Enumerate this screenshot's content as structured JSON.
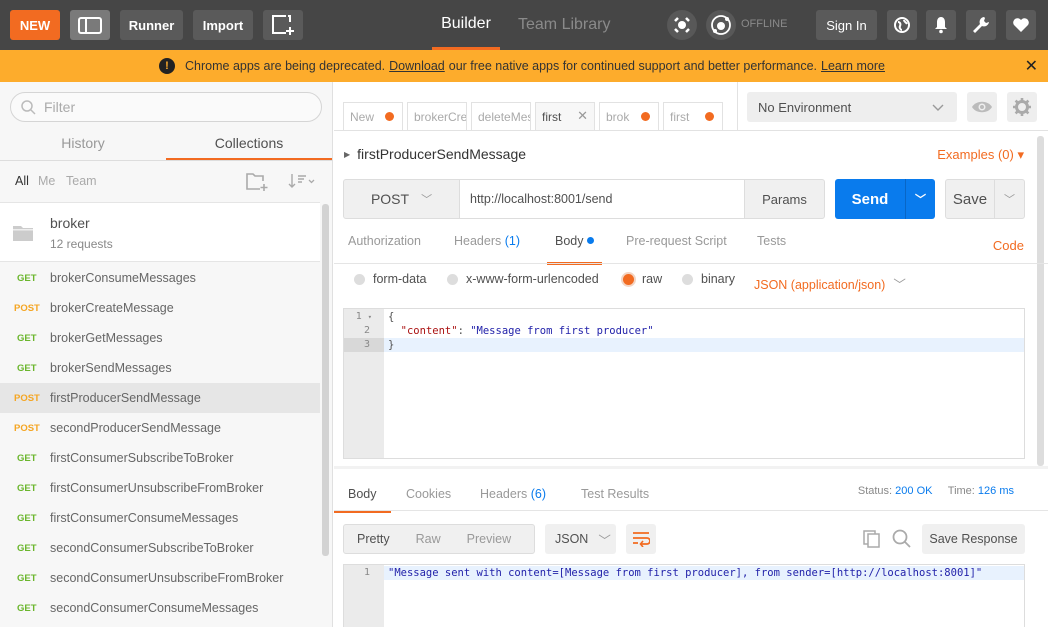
{
  "topbar": {
    "new_label": "NEW",
    "runner_label": "Runner",
    "import_label": "Import",
    "builder_tab": "Builder",
    "team_library_tab": "Team Library",
    "sync_status": "OFFLINE",
    "signin_label": "Sign In",
    "accent_color": "#f26b21"
  },
  "banner": {
    "text_before": "Chrome apps are being deprecated.",
    "download_link": "Download",
    "text_after": "our free native apps for continued support and better performance.",
    "learn_more_link": "Learn more",
    "close": "✕"
  },
  "sidebar": {
    "filter_placeholder": "Filter",
    "tabs": [
      {
        "label": "History"
      },
      {
        "label": "Collections"
      }
    ],
    "filters": [
      "All",
      "Me",
      "Team"
    ],
    "collection": {
      "name": "broker",
      "count": "12 requests"
    },
    "requests": [
      {
        "method": "GET",
        "name": "brokerConsumeMessages"
      },
      {
        "method": "POST",
        "name": "brokerCreateMessage"
      },
      {
        "method": "GET",
        "name": "brokerGetMessages"
      },
      {
        "method": "GET",
        "name": "brokerSendMessages"
      },
      {
        "method": "POST",
        "name": "firstProducerSendMessage",
        "selected": true
      },
      {
        "method": "POST",
        "name": "secondProducerSendMessage"
      },
      {
        "method": "GET",
        "name": "firstConsumerSubscribeToBroker"
      },
      {
        "method": "GET",
        "name": "firstConsumerUnsubscribeFromBroker"
      },
      {
        "method": "GET",
        "name": "firstConsumerConsumeMessages"
      },
      {
        "method": "GET",
        "name": "secondConsumerSubscribeToBroker"
      },
      {
        "method": "GET",
        "name": "secondConsumerUnsubscribeFromBroker"
      },
      {
        "method": "GET",
        "name": "secondConsumerConsumeMessages"
      }
    ]
  },
  "tabs": [
    {
      "label": "New",
      "unsaved": true
    },
    {
      "label": "brokerCre",
      "unsaved": false
    },
    {
      "label": "deleteMes",
      "unsaved": false
    },
    {
      "label": "first",
      "active": true
    },
    {
      "label": "brok",
      "unsaved": true
    },
    {
      "label": "first",
      "unsaved": true
    }
  ],
  "environment": {
    "selected": "No Environment"
  },
  "request": {
    "name": "firstProducerSendMessage",
    "examples": "Examples (0)",
    "method": "POST",
    "url": "http://localhost:8001/send",
    "params_label": "Params",
    "send_label": "Send",
    "save_label": "Save",
    "subtabs": {
      "authorization": "Authorization",
      "headers": "Headers",
      "headers_count": "(1)",
      "body": "Body",
      "prerequest": "Pre-request Script",
      "tests": "Tests"
    },
    "code_link": "Code",
    "body_modes": [
      "form-data",
      "x-www-form-urlencoded",
      "raw",
      "binary"
    ],
    "selected_body_mode": "raw",
    "content_type": "JSON (application/json)",
    "body_lines": [
      "1",
      "2",
      "3"
    ],
    "body_code": {
      "open": "{",
      "key": "\"content\"",
      "colon": ": ",
      "value": "\"Message from first producer\"",
      "close": "}"
    }
  },
  "response": {
    "tabs": {
      "body": "Body",
      "cookies": "Cookies",
      "headers": "Headers",
      "headers_count": "(6)",
      "test_results": "Test Results"
    },
    "status_label": "Status:",
    "status_value": "200 OK",
    "time_label": "Time:",
    "time_value": "126 ms",
    "formats": [
      "Pretty",
      "Raw",
      "Preview"
    ],
    "language": "JSON",
    "save_response_label": "Save Response",
    "line_number": "1",
    "body": "\"Message sent with content=[Message from first producer], from sender=[http://localhost:8001]\""
  }
}
